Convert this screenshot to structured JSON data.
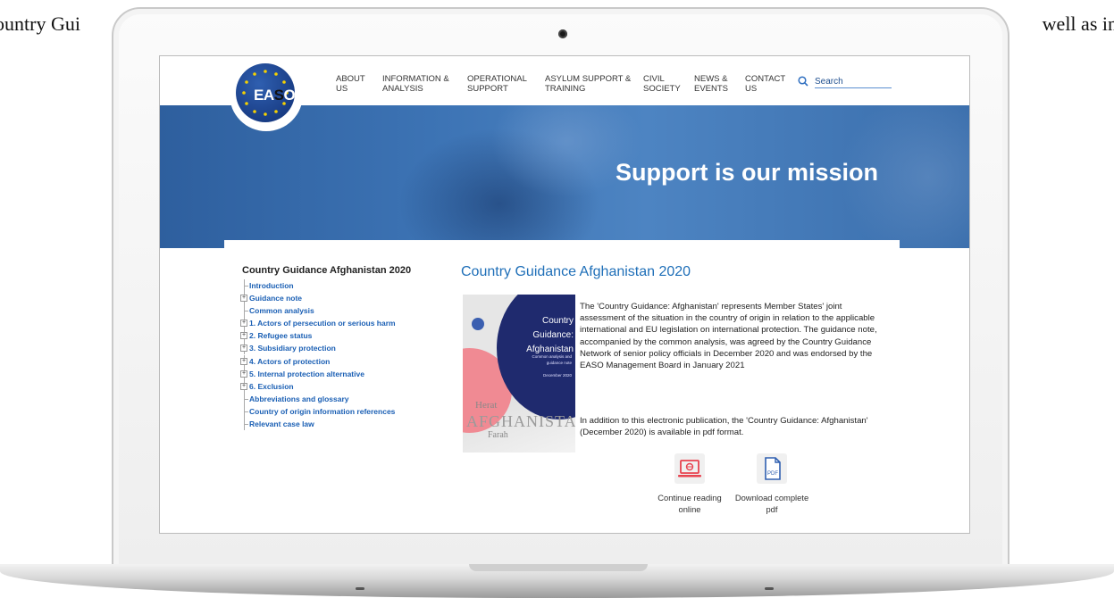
{
  "background": {
    "left_text": "ountry Gui",
    "right_text": "well as in"
  },
  "nav": {
    "logo_text_a": "EA",
    "logo_text_b": "S",
    "logo_text_c": "O",
    "items": [
      {
        "line1": "ABOUT",
        "line2": "US"
      },
      {
        "line1": "INFORMATION &",
        "line2": "ANALYSIS"
      },
      {
        "line1": "OPERATIONAL",
        "line2": "SUPPORT"
      },
      {
        "line1": "ASYLUM SUPPORT &",
        "line2": "TRAINING"
      },
      {
        "line1": "CIVIL",
        "line2": "SOCIETY"
      },
      {
        "line1": "NEWS &",
        "line2": "EVENTS"
      },
      {
        "line1": "CONTACT",
        "line2": "US"
      }
    ],
    "search_placeholder": "Search"
  },
  "hero": {
    "title": "Support is our mission"
  },
  "toc": {
    "title": "Country Guidance Afghanistan 2020",
    "items": [
      {
        "label": "Introduction",
        "expandable": false
      },
      {
        "label": "Guidance note",
        "expandable": true
      },
      {
        "label": "Common analysis",
        "expandable": false
      },
      {
        "label": "1. Actors of persecution or serious harm",
        "expandable": true
      },
      {
        "label": "2. Refugee status",
        "expandable": true
      },
      {
        "label": "3. Subsidiary protection",
        "expandable": true
      },
      {
        "label": "4. Actors of protection",
        "expandable": true
      },
      {
        "label": "5. Internal protection alternative",
        "expandable": true
      },
      {
        "label": "6. Exclusion",
        "expandable": true
      },
      {
        "label": "Abbreviations and glossary",
        "expandable": false
      },
      {
        "label": "Country of origin information references",
        "expandable": false
      },
      {
        "label": "Relevant case law",
        "expandable": false
      }
    ]
  },
  "main": {
    "title": "Country Guidance Afghanistan 2020",
    "cover": {
      "title_line1": "Country Guidance:",
      "title_line2": "Afghanistan",
      "subtitle": "Common analysis and guidance note",
      "date": "December 2020",
      "map_city1": "Herat",
      "map_country": "AFGHANISTAN",
      "map_city2": "Farah"
    },
    "paragraph1": "The 'Country Guidance: Afghanistan' represents Member States' joint assessment of the situation in the country of origin in relation to the applicable international and EU legislation on international protection. The guidance note, accompanied by the common analysis, was agreed by the Country Guidance Network of senior policy officials in December 2020 and was endorsed by the EASO Management Board in January 2021",
    "paragraph2": "In addition to this electronic publication, the 'Country Guidance: Afghanistan' (December 2020) is available in pdf format.",
    "actions": [
      {
        "label": "Continue reading online",
        "icon": "laptop-web-icon"
      },
      {
        "label": "Download complete pdf",
        "icon": "pdf-file-icon"
      }
    ],
    "pdf_icon_text": "PDF"
  },
  "colors": {
    "link_blue": "#1a5fb4",
    "title_blue": "#1f6fb8",
    "hero_blue": "#3d74b5",
    "accent_red": "#e8434f"
  }
}
